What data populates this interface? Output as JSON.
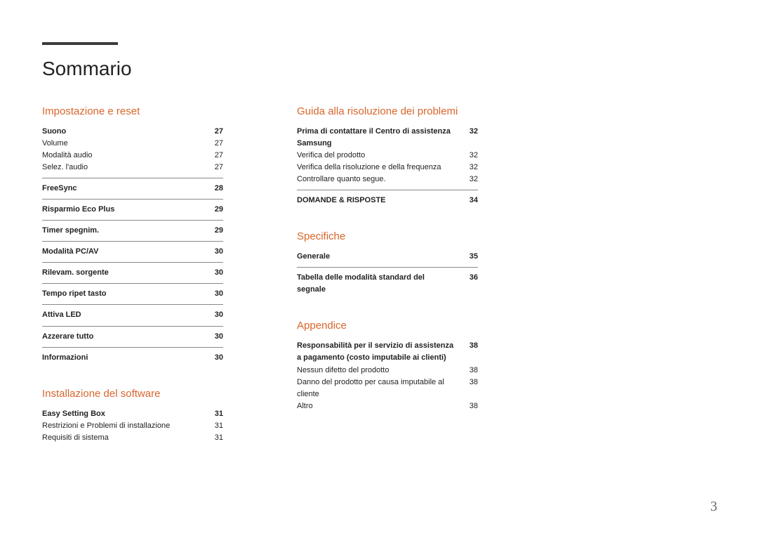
{
  "page_title": "Sommario",
  "page_number": "3",
  "left": {
    "section1": {
      "title": "Impostazione e reset",
      "groups": [
        {
          "head": {
            "label": "Suono",
            "page": "27"
          },
          "items": [
            {
              "label": "Volume",
              "page": "27"
            },
            {
              "label": "Modalità audio",
              "page": "27"
            },
            {
              "label": "Selez. l'audio",
              "page": "27"
            }
          ]
        },
        {
          "head": {
            "label": "FreeSync",
            "page": "28"
          },
          "items": []
        },
        {
          "head": {
            "label": "Risparmio Eco Plus",
            "page": "29"
          },
          "items": []
        },
        {
          "head": {
            "label": "Timer spegnim.",
            "page": "29"
          },
          "items": []
        },
        {
          "head": {
            "label": "Modalità PC/AV",
            "page": "30"
          },
          "items": []
        },
        {
          "head": {
            "label": "Rilevam. sorgente",
            "page": "30"
          },
          "items": []
        },
        {
          "head": {
            "label": "Tempo ripet tasto",
            "page": "30"
          },
          "items": []
        },
        {
          "head": {
            "label": "Attiva LED",
            "page": "30"
          },
          "items": []
        },
        {
          "head": {
            "label": "Azzerare tutto",
            "page": "30"
          },
          "items": []
        },
        {
          "head": {
            "label": "Informazioni",
            "page": "30"
          },
          "items": []
        }
      ]
    },
    "section2": {
      "title": "Installazione del software",
      "groups": [
        {
          "head": {
            "label": "Easy Setting Box",
            "page": "31"
          },
          "items": [
            {
              "label": "Restrizioni e Problemi di installazione",
              "page": "31"
            },
            {
              "label": "Requisiti di sistema",
              "page": "31"
            }
          ]
        }
      ]
    }
  },
  "right": {
    "section1": {
      "title": "Guida alla risoluzione dei problemi",
      "groups": [
        {
          "head": {
            "label": "Prima di contattare il Centro di assistenza Samsung",
            "page": "32"
          },
          "items": [
            {
              "label": "Verifica del prodotto",
              "page": "32"
            },
            {
              "label": "Verifica della risoluzione e della frequenza",
              "page": "32"
            },
            {
              "label": "Controllare quanto segue.",
              "page": "32"
            }
          ]
        },
        {
          "head": {
            "label": "DOMANDE & RISPOSTE",
            "page": "34"
          },
          "items": []
        }
      ]
    },
    "section2": {
      "title": "Specifiche",
      "groups": [
        {
          "head": {
            "label": "Generale",
            "page": "35"
          },
          "items": []
        },
        {
          "head": {
            "label": "Tabella delle modalità standard del segnale",
            "page": "36"
          },
          "items": []
        }
      ]
    },
    "section3": {
      "title": "Appendice",
      "groups": [
        {
          "head": {
            "label": "Responsabilità per il servizio di assistenza a pagamento (costo imputabile ai clienti)",
            "page": "38"
          },
          "items": [
            {
              "label": "Nessun difetto del prodotto",
              "page": "38"
            },
            {
              "label": "Danno del prodotto per causa imputabile al cliente",
              "page": "38"
            },
            {
              "label": "Altro",
              "page": "38"
            }
          ]
        }
      ]
    }
  }
}
